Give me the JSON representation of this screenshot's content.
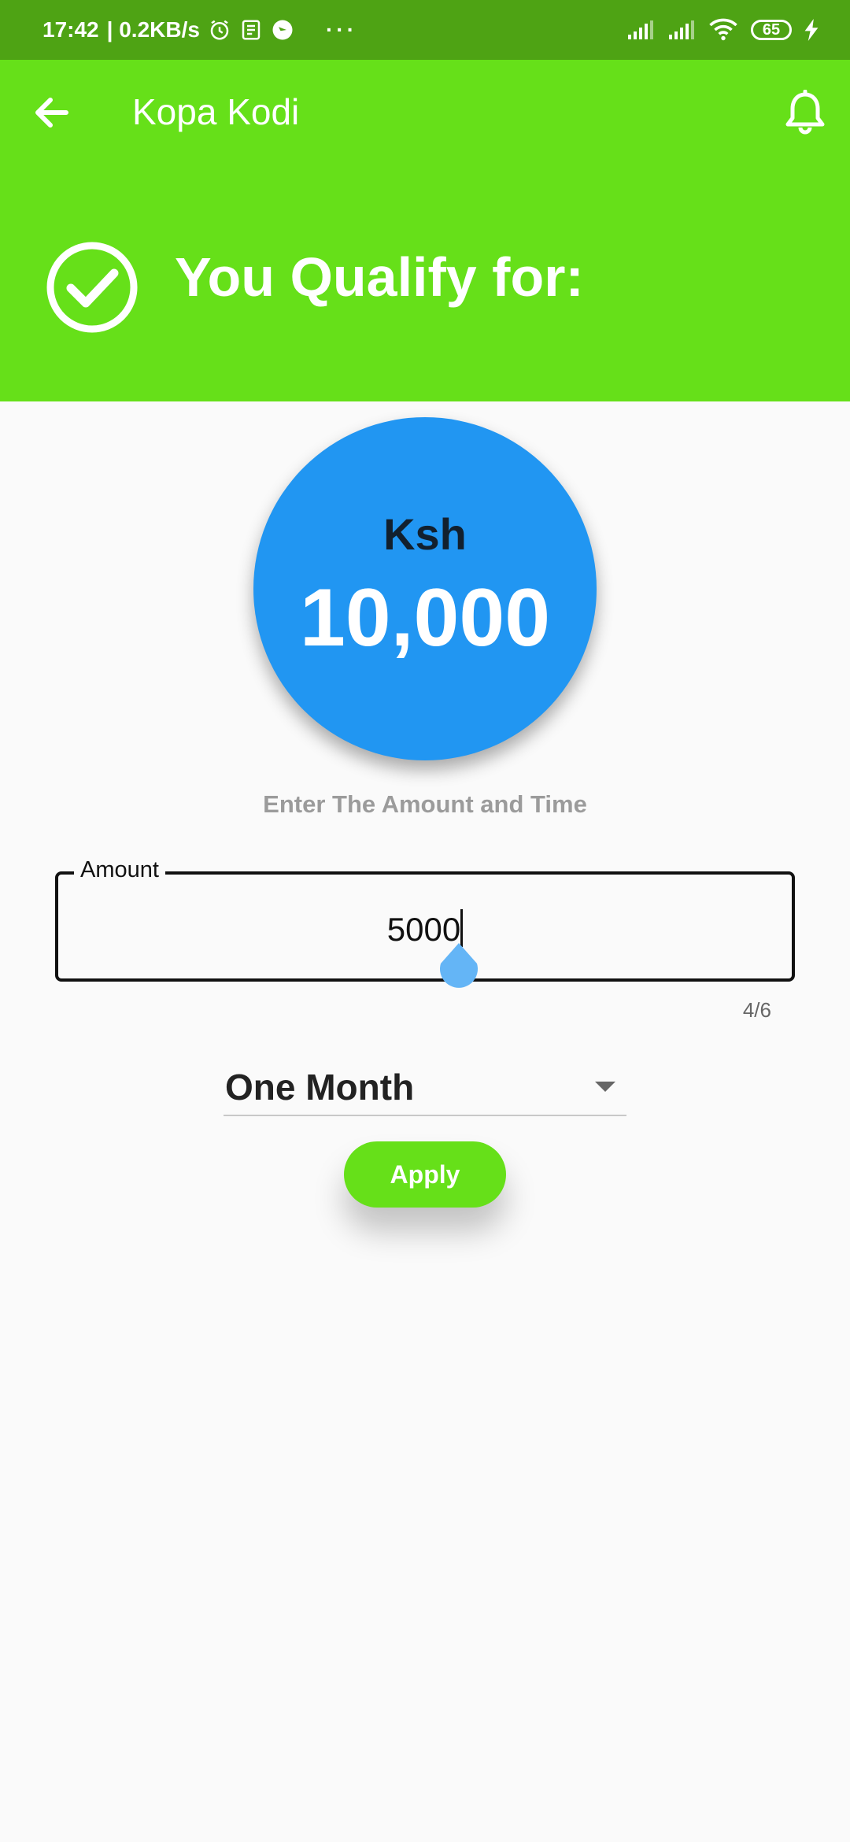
{
  "status_bar": {
    "time": "17:42",
    "speed": "| 0.2KB/s",
    "dots": "···",
    "battery": "65",
    "icons": [
      "alarm-icon",
      "news-icon",
      "app-icon",
      "signal-icon",
      "signal-icon",
      "wifi-icon",
      "battery-icon",
      "charging-icon"
    ]
  },
  "app_bar": {
    "title": "Kopa Kodi",
    "icons": [
      "back-arrow-icon",
      "bell-icon"
    ]
  },
  "hero": {
    "title": "You Qualify for:",
    "icon": "check-circle-icon"
  },
  "limit": {
    "currency": "Ksh",
    "amount": "10,000"
  },
  "form": {
    "instruction": "Enter The Amount and Time",
    "amount_label": "Amount",
    "amount_value": "5000",
    "counter": "4/6",
    "period": "One Month",
    "apply_label": "Apply"
  },
  "colors": {
    "status_bar": "#4ea314",
    "primary_green": "#66e019",
    "circle_blue": "#2196f2",
    "handle_blue": "#64b5f6"
  }
}
